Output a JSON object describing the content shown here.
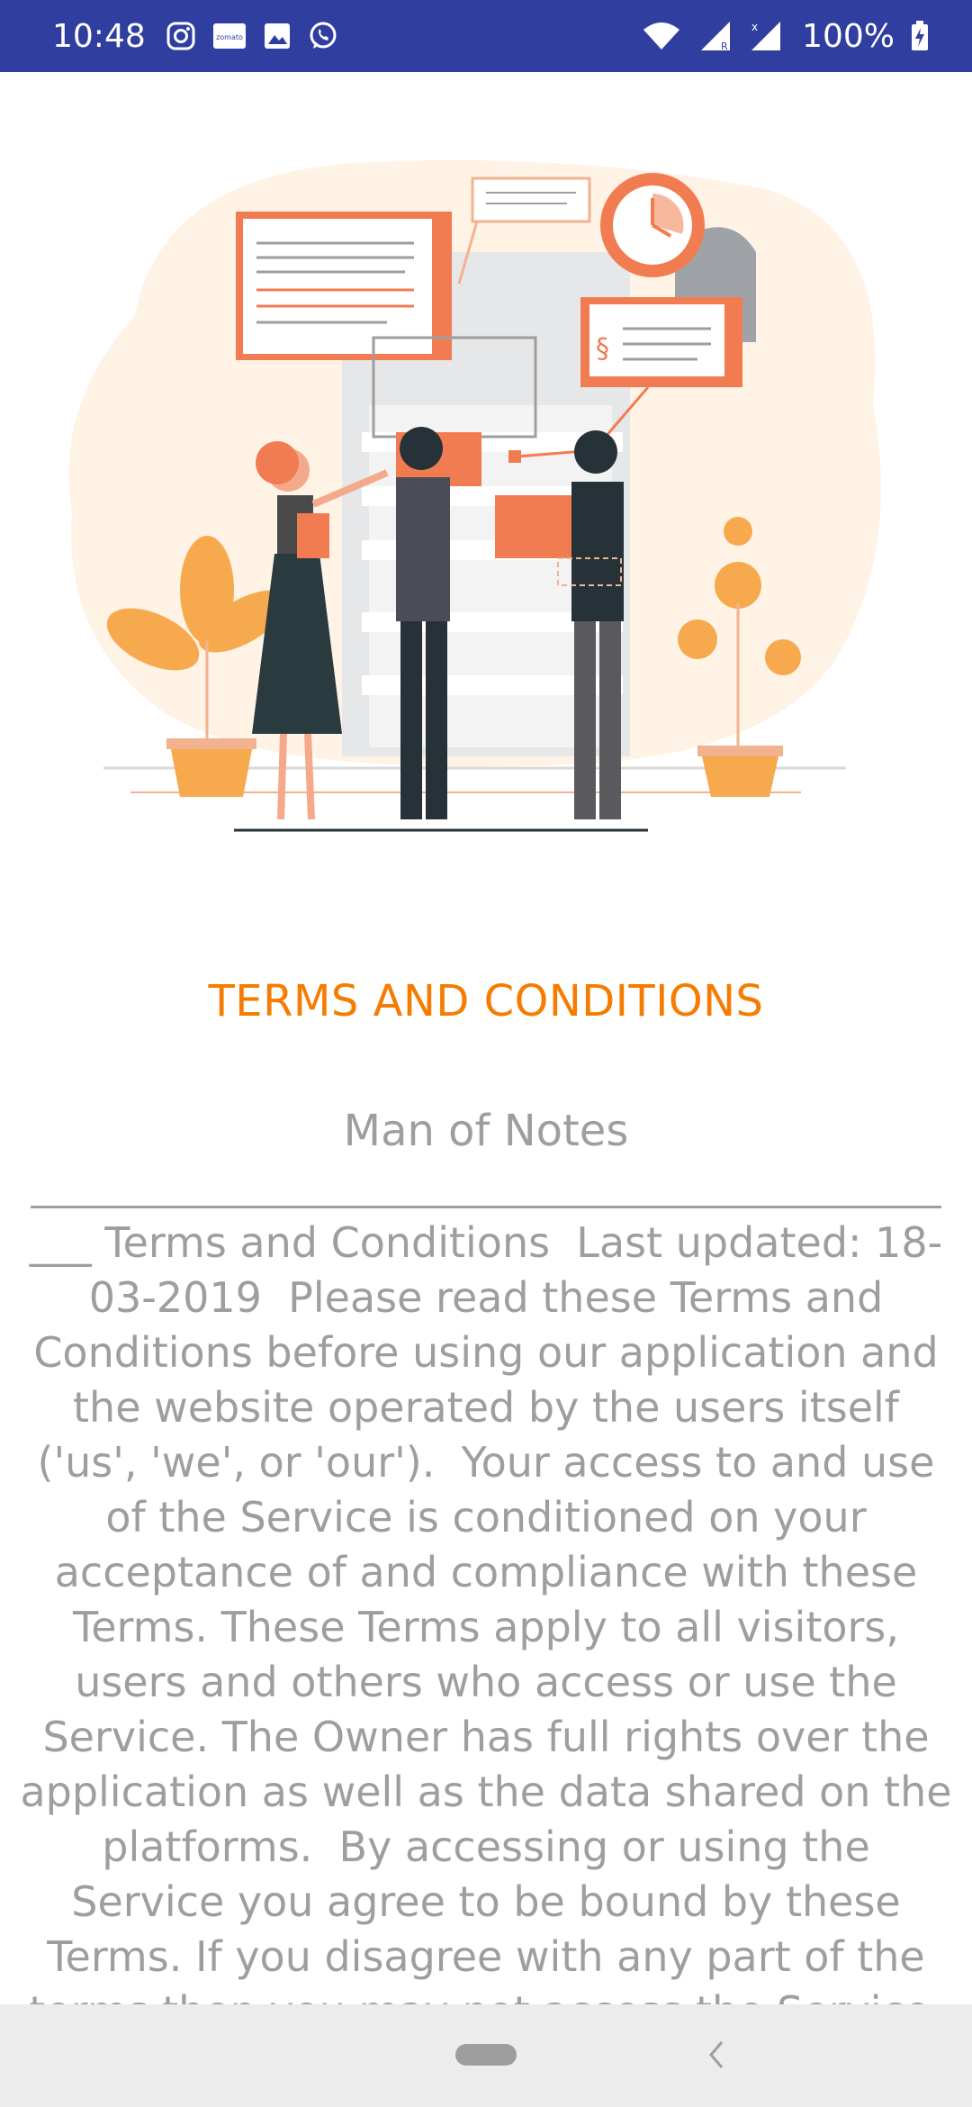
{
  "status_bar": {
    "time": "10:48",
    "left_icons": [
      "instagram-icon",
      "zomato-icon",
      "gallery-icon",
      "whatsapp-icon"
    ],
    "zomato_text": "zomato",
    "right_icons": [
      "wifi-icon",
      "signal-r-icon",
      "signal-x-icon",
      "battery-charging-icon"
    ],
    "battery": "100%",
    "color": "#303f9f"
  },
  "illustration": {
    "name": "people-reviewing-documents-illustration",
    "section_mark": "§",
    "accent": "#f27c52"
  },
  "page": {
    "title": "TERMS AND CONDITIONS",
    "title_color": "#f57c00",
    "app_name": "Man of Notes",
    "body": "___ Terms and Conditions  Last updated: 18-03-2019  Please read these Terms and Conditions before using our application and the website operated by the users itself ('us', 'we', or 'our').  Your access to and use of the Service is conditioned on your acceptance of and compliance with these Terms. These Terms apply to all visitors, users and others who access or use the Service. The Owner has full rights over the application as well as the data shared on the platforms.  By accessing or using the Service you agree to be bound by these Terms. If you disagree with any part of the terms then you may not access the Service.",
    "text_color": "#9e9e9e"
  },
  "nav_bar": {
    "icons": [
      "home-pill-icon",
      "back-chevron-icon"
    ]
  }
}
